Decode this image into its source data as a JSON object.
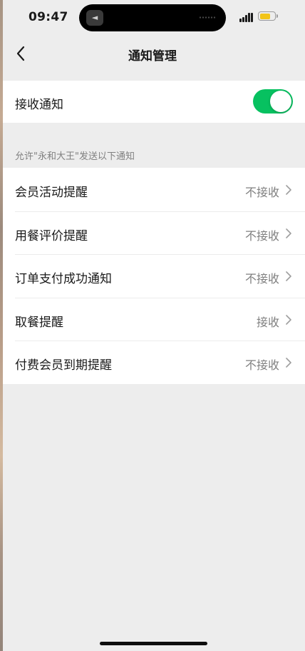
{
  "status_bar": {
    "time": "09:47",
    "battery_color": "#f2c417"
  },
  "nav": {
    "title": "通知管理",
    "back_icon": "chevron-left-icon"
  },
  "receive_toggle": {
    "label": "接收通知",
    "enabled": true,
    "color": "#07c160"
  },
  "section_caption": "允许\"永和大王\"发送以下通知",
  "notifications": [
    {
      "label": "会员活动提醒",
      "value": "不接收"
    },
    {
      "label": "用餐评价提醒",
      "value": "不接收"
    },
    {
      "label": "订单支付成功通知",
      "value": "不接收"
    },
    {
      "label": "取餐提醒",
      "value": "接收"
    },
    {
      "label": "付费会员到期提醒",
      "value": "不接收"
    }
  ]
}
